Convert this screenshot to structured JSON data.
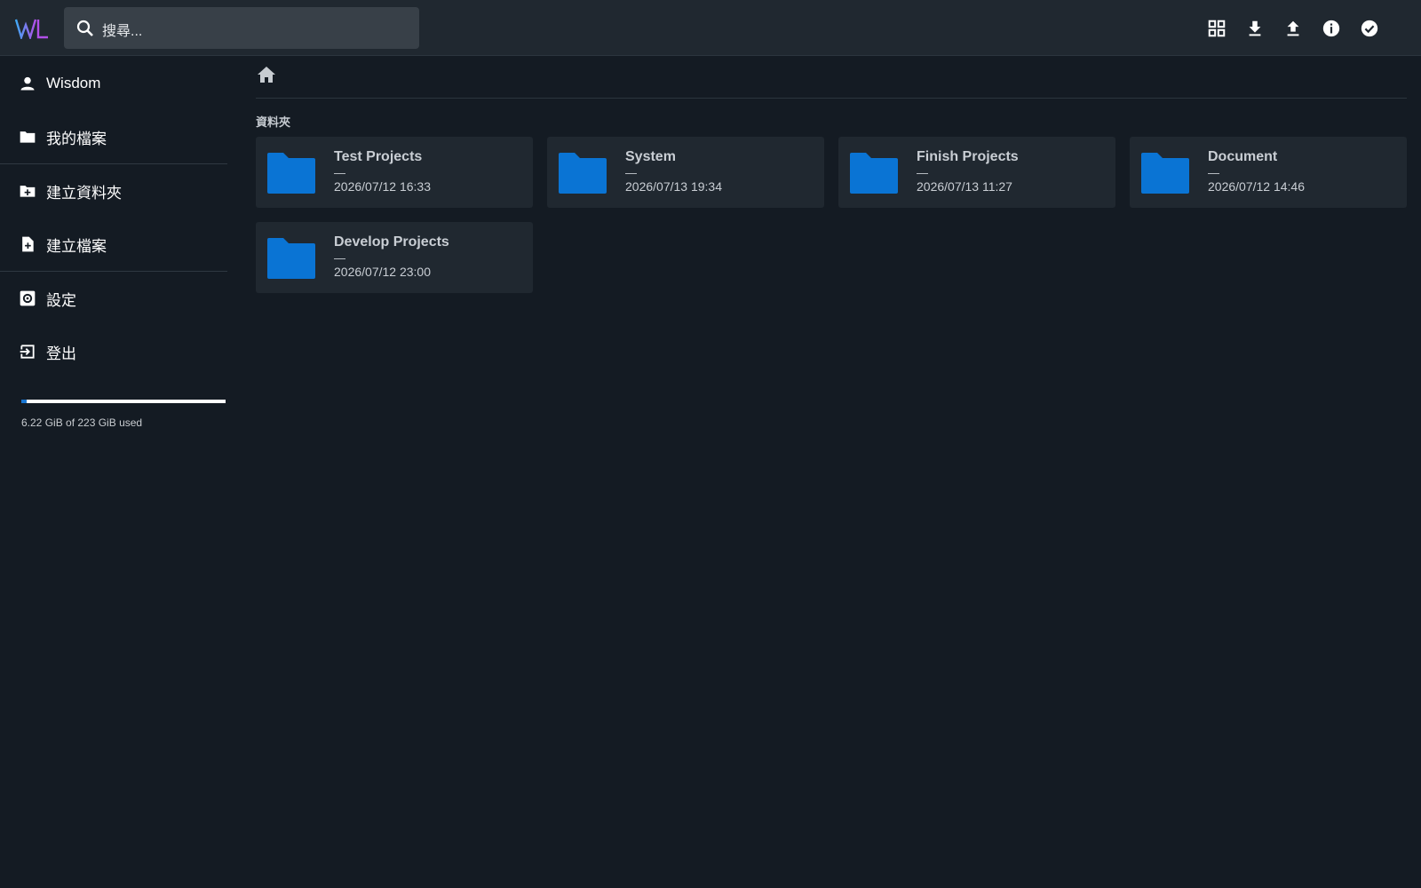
{
  "search": {
    "placeholder": "搜尋..."
  },
  "sidebar": {
    "items": [
      {
        "label": "Wisdom",
        "icon": "person-icon"
      },
      {
        "label": "我的檔案",
        "icon": "folder-icon"
      },
      {
        "label": "建立資料夾",
        "icon": "create-folder-icon"
      },
      {
        "label": "建立檔案",
        "icon": "create-file-icon"
      },
      {
        "label": "設定",
        "icon": "settings-icon"
      },
      {
        "label": "登出",
        "icon": "logout-icon"
      }
    ]
  },
  "usage": {
    "text": "6.22 GiB of 223 GiB used",
    "fraction": 0.0279
  },
  "main": {
    "section_title": "資料夾",
    "folders": [
      {
        "name": "Test Projects",
        "size": "—",
        "date": "2026/07/12 16:33"
      },
      {
        "name": "System",
        "size": "—",
        "date": "2026/07/13 19:34"
      },
      {
        "name": "Finish Projects",
        "size": "—",
        "date": "2026/07/13 11:27"
      },
      {
        "name": "Document",
        "size": "—",
        "date": "2026/07/12 14:46"
      },
      {
        "name": "Develop Projects",
        "size": "—",
        "date": "2026/07/12 23:00"
      }
    ]
  },
  "colors": {
    "accent": "#1976d2",
    "folder": "#0a74d4",
    "background": "#141b23"
  },
  "toolbar": {
    "icons": [
      "grid-view-icon",
      "download-icon",
      "upload-icon",
      "info-icon",
      "check-circle-icon"
    ]
  }
}
